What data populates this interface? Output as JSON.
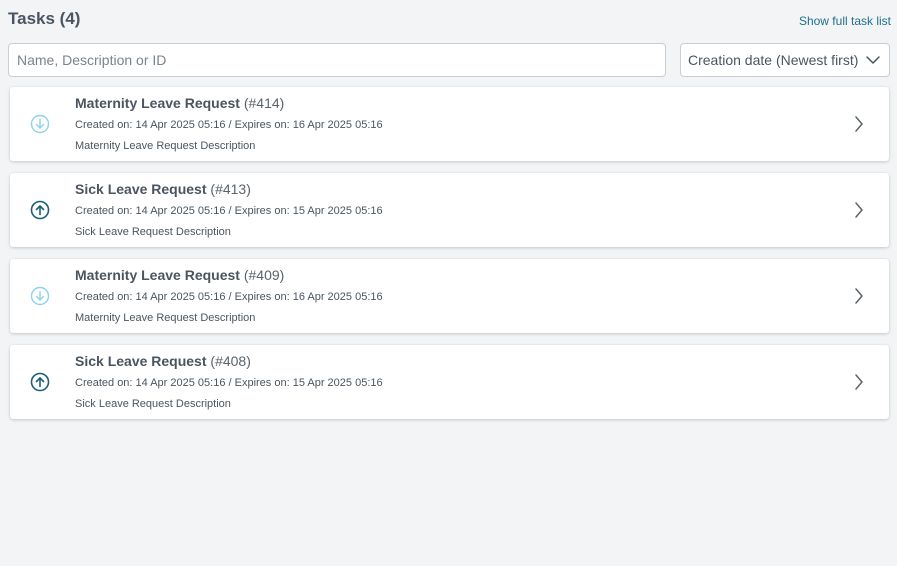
{
  "header": {
    "title": "Tasks (4)",
    "show_full_link": "Show full task list"
  },
  "search": {
    "placeholder": "Name, Description or ID",
    "value": ""
  },
  "sort": {
    "selected": "Creation date (Newest first)"
  },
  "colors": {
    "incoming_icon": "#8fd3e6",
    "outgoing_icon": "#1a5f78",
    "link": "#1f6f8b"
  },
  "tasks": [
    {
      "name": "Maternity Leave Request",
      "id": "(#414)",
      "dates": "Created on: 14 Apr 2025 05:16 / Expires on: 16 Apr 2025 05:16",
      "description": "Maternity Leave Request Description",
      "icon": "arrow-down-circle-icon"
    },
    {
      "name": "Sick Leave Request",
      "id": "(#413)",
      "dates": "Created on: 14 Apr 2025 05:16 / Expires on: 15 Apr 2025 05:16",
      "description": "Sick Leave Request Description",
      "icon": "arrow-up-circle-icon"
    },
    {
      "name": "Maternity Leave Request",
      "id": "(#409)",
      "dates": "Created on: 14 Apr 2025 05:16 / Expires on: 16 Apr 2025 05:16",
      "description": "Maternity Leave Request Description",
      "icon": "arrow-down-circle-icon"
    },
    {
      "name": "Sick Leave Request",
      "id": "(#408)",
      "dates": "Created on: 14 Apr 2025 05:16 / Expires on: 15 Apr 2025 05:16",
      "description": "Sick Leave Request Description",
      "icon": "arrow-up-circle-icon"
    }
  ]
}
